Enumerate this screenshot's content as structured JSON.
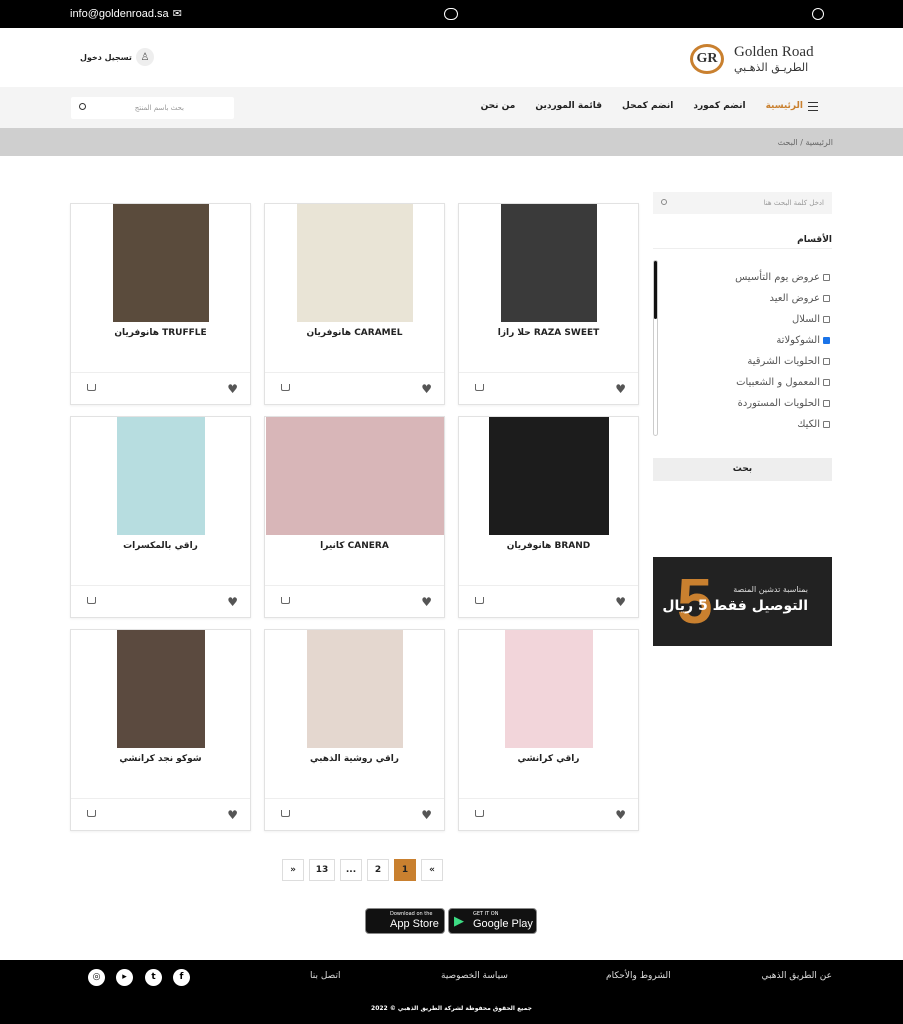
{
  "topbar": {
    "email": "info@goldenroad.sa"
  },
  "header": {
    "login_label": "تسجيل دخول",
    "logo_en": "Golden Road",
    "logo_ar": "الطريـق الذهـبي",
    "logo_mark": "GR"
  },
  "nav": {
    "search_placeholder": "بحث باسم المنتج",
    "items": [
      "الرئيسية",
      "انضم كمورد",
      "انضم كمحل",
      "قائمة الموردين",
      "من نحن"
    ]
  },
  "breadcrumb": "الرئيسية / البحث",
  "sidebar": {
    "search_placeholder": "ادخل كلمة البحث هنا",
    "categories_title": "الأقسام",
    "categories": [
      {
        "label": "عروض يوم التأسيس",
        "checked": false
      },
      {
        "label": "عروض العيد",
        "checked": false
      },
      {
        "label": "السلال",
        "checked": false
      },
      {
        "label": "الشوكولاتة",
        "checked": true
      },
      {
        "label": "الحلويات الشرقية",
        "checked": false
      },
      {
        "label": "المعمول و الشعبيات",
        "checked": false
      },
      {
        "label": "الحلويات المستوردة",
        "checked": false
      },
      {
        "label": "الكيك",
        "checked": false
      }
    ],
    "search_button": "بحث",
    "banner": {
      "number": "5",
      "line1": "بمناسبة تدشين المنصة",
      "line2": "التوصيل فقط 5 ريال"
    }
  },
  "products": [
    {
      "title": "حلا رازا RAZA SWEET",
      "bg": "#3a3a3a"
    },
    {
      "title": "هانوفريان CARAMEL",
      "bg": "#e9e4d6"
    },
    {
      "title": "هانوفريان TRUFFLE",
      "bg": "#5a4b3c"
    },
    {
      "title": "هانوفريان BRAND",
      "bg": "#1c1c1c"
    },
    {
      "title": "كانيرا CANERA",
      "bg": "#d8b6b8"
    },
    {
      "title": "راقي بالمكسرات",
      "bg": "#b7dde0"
    },
    {
      "title": "راقي كرانشي",
      "bg": "#f2d5da"
    },
    {
      "title": "راقي روشية الذهبي",
      "bg": "#e4d7cf"
    },
    {
      "title": "شوكو نجد كرانشي",
      "bg": "#5b4a3f"
    }
  ],
  "pagination": [
    "»",
    "1",
    "2",
    "...",
    "13",
    "«"
  ],
  "apps": {
    "apple_small": "Download on the",
    "apple_big": "App Store",
    "google_small": "GET IT ON",
    "google_big": "Google Play"
  },
  "footer": {
    "links": [
      "عن الطريق الذهبي",
      "الشروط والأحكام",
      "سياسة الخصوصية",
      "اتصل بنا"
    ],
    "copyright": "جميع الحقوق محفوظة لشركة الطريق الذهبي © 2022"
  }
}
